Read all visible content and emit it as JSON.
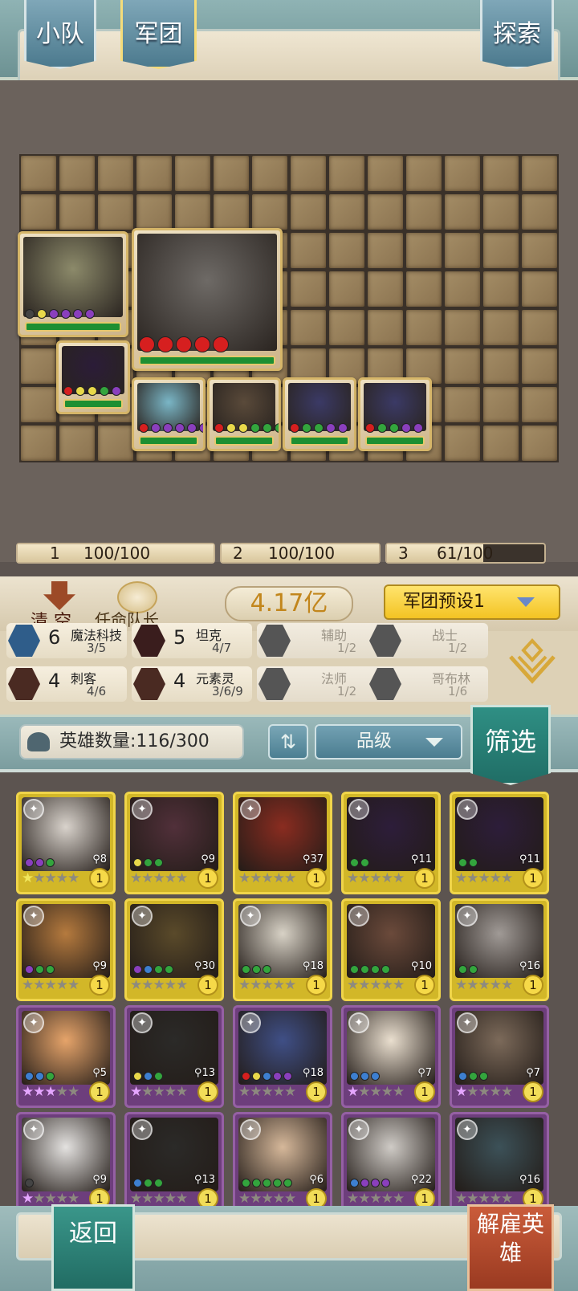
{
  "header": {
    "tab_team": "小队",
    "tab_legion": "军团",
    "explore": "探索"
  },
  "board": {
    "units": [
      {
        "dots": [
          "#444",
          "#e8d84a",
          "#8a3fbd",
          "#8a3fbd",
          "#8a3fbd",
          "#8a3fbd"
        ]
      },
      {
        "dots": [
          "#d61f1f",
          "#d61f1f",
          "#d61f1f",
          "#d61f1f",
          "#d61f1f"
        ]
      },
      {
        "dots": [
          "#d61f1f",
          "#e8d84a",
          "#e8d84a",
          "#33a53d",
          "#8a3fbd"
        ]
      },
      {
        "dots": [
          "#d61f1f",
          "#8a3fbd",
          "#8a3fbd",
          "#8a3fbd",
          "#8a3fbd",
          "#8a3fbd"
        ]
      },
      {
        "dots": [
          "#d61f1f",
          "#e8d84a",
          "#e8d84a",
          "#33a53d",
          "#33a53d",
          "#33a53d"
        ]
      },
      {
        "dots": [
          "#d61f1f",
          "#33a53d",
          "#33a53d",
          "#8a3fbd",
          "#8a3fbd"
        ]
      },
      {
        "dots": [
          "#d61f1f",
          "#33a53d",
          "#33a53d",
          "#8a3fbd",
          "#8a3fbd"
        ]
      }
    ]
  },
  "strips": [
    {
      "index": "1",
      "value": "100/100",
      "ratio": 1.0
    },
    {
      "index": "2",
      "value": "100/100",
      "ratio": 1.0
    },
    {
      "index": "3",
      "value": "61/100",
      "ratio": 0.61
    }
  ],
  "controls": {
    "clear": "清 空",
    "appoint_captain": "任命队长",
    "power": "4.17亿",
    "preset": "军团预设1"
  },
  "traits": [
    {
      "count": "6",
      "name": "魔法科技",
      "progress": "3/5",
      "active": true,
      "color": "#2f5d8a"
    },
    {
      "count": "5",
      "name": "坦克",
      "progress": "4/7",
      "active": true,
      "color": "#3a1d1d"
    },
    {
      "count": "",
      "name": "辅助",
      "progress": "1/2",
      "active": false,
      "color": "#555"
    },
    {
      "count": "",
      "name": "战士",
      "progress": "1/2",
      "active": false,
      "color": "#555"
    },
    {
      "count": "4",
      "name": "刺客",
      "progress": "4/6",
      "active": true,
      "color": "#4a2a22"
    },
    {
      "count": "4",
      "name": "元素灵",
      "progress": "3/6/9",
      "active": true,
      "color": "#4a2a22"
    },
    {
      "count": "",
      "name": "法师",
      "progress": "1/2",
      "active": false,
      "color": "#555"
    },
    {
      "count": "",
      "name": "哥布林",
      "progress": "1/6",
      "active": false,
      "color": "#555"
    }
  ],
  "hero_bar": {
    "count_label": "英雄数量:116/300",
    "sort_icon": "⇅",
    "grade": "品级",
    "filter": "筛选"
  },
  "heroes": [
    {
      "rarity": "gold",
      "cost": "8",
      "stars": 1,
      "level": "1",
      "dots": [
        "#8a3fbd",
        "#8a3fbd",
        "#33a53d"
      ],
      "art": "#d9d3cc"
    },
    {
      "rarity": "gold",
      "cost": "9",
      "stars": 0,
      "level": "1",
      "dots": [
        "#e8d84a",
        "#33a53d",
        "#33a53d"
      ],
      "art": "#51303a"
    },
    {
      "rarity": "gold",
      "cost": "37",
      "stars": 0,
      "level": "1",
      "dots": [],
      "art": "#8a2c20"
    },
    {
      "rarity": "gold",
      "cost": "11",
      "stars": 0,
      "level": "1",
      "dots": [
        "#33a53d",
        "#33a53d"
      ],
      "art": "#2d1d3a"
    },
    {
      "rarity": "gold",
      "cost": "11",
      "stars": 0,
      "level": "1",
      "dots": [
        "#33a53d",
        "#33a53d"
      ],
      "art": "#2d1d3a"
    },
    {
      "rarity": "gold",
      "cost": "9",
      "stars": 0,
      "level": "1",
      "dots": [
        "#8a3fbd",
        "#33a53d",
        "#33a53d"
      ],
      "art": "#b57a3e"
    },
    {
      "rarity": "gold",
      "cost": "30",
      "stars": 0,
      "level": "1",
      "dots": [
        "#8a3fbd",
        "#3d7fd0",
        "#33a53d",
        "#33a53d"
      ],
      "art": "#5a4a2a"
    },
    {
      "rarity": "gold",
      "cost": "18",
      "stars": 0,
      "level": "1",
      "dots": [
        "#33a53d",
        "#33a53d",
        "#33a53d"
      ],
      "art": "#d8d2c6"
    },
    {
      "rarity": "gold",
      "cost": "10",
      "stars": 0,
      "level": "1",
      "dots": [
        "#33a53d",
        "#33a53d",
        "#33a53d",
        "#33a53d"
      ],
      "art": "#6b4a3b"
    },
    {
      "rarity": "gold",
      "cost": "16",
      "stars": 0,
      "level": "1",
      "dots": [
        "#33a53d",
        "#33a53d"
      ],
      "art": "#a09a96"
    },
    {
      "rarity": "purple",
      "cost": "5",
      "stars": 3,
      "level": "1",
      "dots": [
        "#3d7fd0",
        "#3d7fd0",
        "#33a53d"
      ],
      "art": "#e6a46a"
    },
    {
      "rarity": "purple",
      "cost": "13",
      "stars": 1,
      "level": "1",
      "dots": [
        "#e8d84a",
        "#3d7fd0",
        "#33a53d"
      ],
      "art": "#2b2a28"
    },
    {
      "rarity": "purple",
      "cost": "18",
      "stars": 0,
      "level": "1",
      "dots": [
        "#d61f1f",
        "#e8d84a",
        "#3d7fd0",
        "#8a3fbd",
        "#8a3fbd"
      ],
      "art": "#3f4f86"
    },
    {
      "rarity": "purple",
      "cost": "7",
      "stars": 1,
      "level": "1",
      "dots": [
        "#3d7fd0",
        "#3d7fd0",
        "#3d7fd0"
      ],
      "art": "#eadfcf"
    },
    {
      "rarity": "purple",
      "cost": "7",
      "stars": 1,
      "level": "1",
      "dots": [
        "#3d7fd0",
        "#33a53d",
        "#33a53d"
      ],
      "art": "#7c6a5a"
    },
    {
      "rarity": "purple",
      "cost": "9",
      "stars": 1,
      "level": "1",
      "dots": [
        "#444"
      ],
      "art": "#e4e2e0"
    },
    {
      "rarity": "purple",
      "cost": "13",
      "stars": 0,
      "level": "1",
      "dots": [
        "#3d7fd0",
        "#33a53d",
        "#33a53d"
      ],
      "art": "#2b2a28"
    },
    {
      "rarity": "purple",
      "cost": "6",
      "stars": 0,
      "level": "1",
      "dots": [
        "#33a53d",
        "#33a53d",
        "#33a53d",
        "#33a53d",
        "#33a53d"
      ],
      "art": "#d6b89a"
    },
    {
      "rarity": "purple",
      "cost": "22",
      "stars": 0,
      "level": "1",
      "dots": [
        "#3d7fd0",
        "#8a3fbd",
        "#8a3fbd",
        "#8a3fbd"
      ],
      "art": "#cfcbc6"
    },
    {
      "rarity": "purple",
      "cost": "16",
      "stars": 0,
      "level": "1",
      "dots": [],
      "art": "#3c5158"
    }
  ],
  "bottom": {
    "back": "返回",
    "dismiss": "解雇英雄"
  }
}
